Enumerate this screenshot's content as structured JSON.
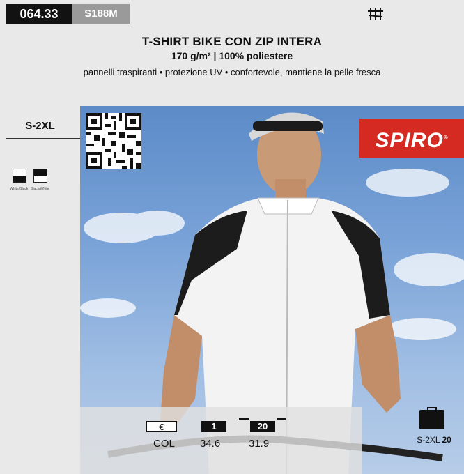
{
  "header": {
    "code": "064.33",
    "model": "S188M",
    "title": "T-SHIRT BIKE CON ZIP INTERA",
    "spec": "170 g/m² | 100% poliestere",
    "features": "pannelli traspiranti • protezione UV • confortevole, mantiene la pelle fresca",
    "top_icon": "hanger-icon"
  },
  "sidebar": {
    "sizes": "S-2XL",
    "colors": [
      {
        "name": "White/Black",
        "top": "#ffffff",
        "bottom": "#111111"
      },
      {
        "name": "Black/White",
        "top": "#111111",
        "bottom": "#ffffff"
      }
    ]
  },
  "brand": {
    "logo_text": "SPIRO",
    "reg_mark": "®",
    "color": "#d52a22"
  },
  "pricing": {
    "currency": "€",
    "col_label": "COL",
    "qty_1_label": "1",
    "qty_2_label": "20",
    "price_1": "34.6",
    "price_2": "31.9"
  },
  "packaging": {
    "icon": "carton-box-icon",
    "sizes": "S-2XL",
    "qty": "20"
  }
}
